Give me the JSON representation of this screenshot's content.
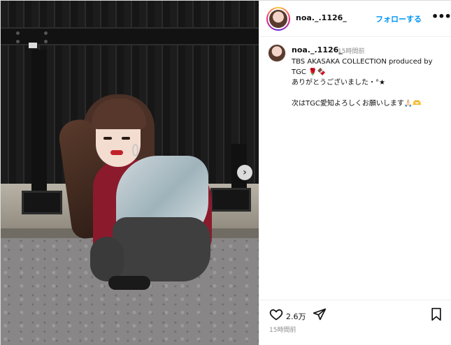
{
  "post": {
    "username": "noa._.1126_",
    "follow_label": "フォローする",
    "more_label": "•••",
    "caption_username": "noa._.1126_",
    "caption_time": "15時間前",
    "caption_text": "TBS AKASAKA COLLECTION produced by TGC 🌹🍫\nありがとうございました・°★\n\n次はTGC愛知よろしくお願いします🙏🏻🫶",
    "likes": "2.6万",
    "post_time": "15時間前",
    "next_label": "›"
  },
  "icons": {
    "heart": "heart-icon",
    "share": "send-icon",
    "save": "bookmark-icon",
    "next": "chevron-right-icon"
  },
  "colors": {
    "link": "#0095f6",
    "muted": "#8e8e8e",
    "jacket": "#8b1a2c"
  }
}
